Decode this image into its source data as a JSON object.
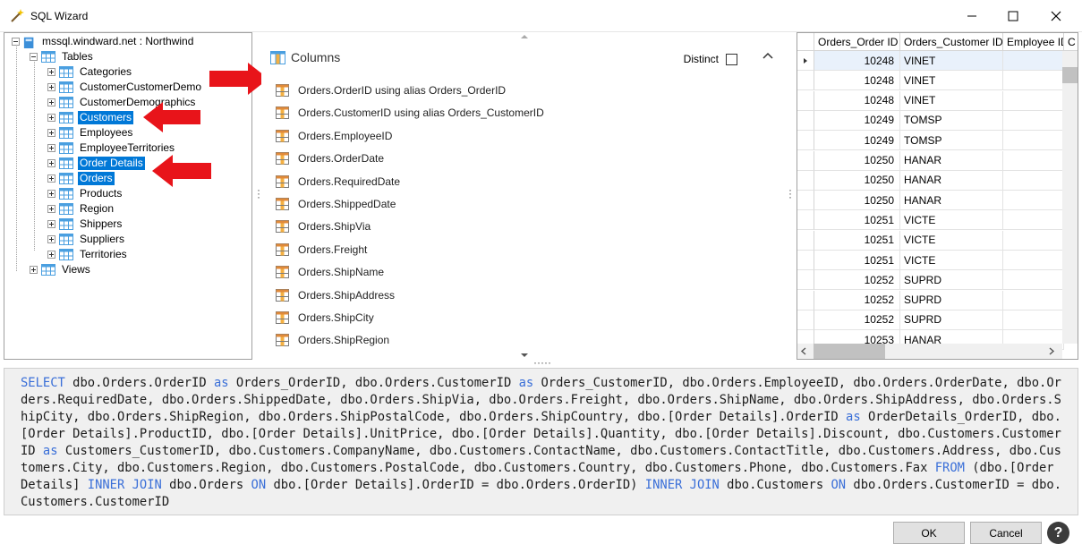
{
  "window": {
    "title": "SQL Wizard"
  },
  "tree": {
    "root_label": "mssql.windward.net : Northwind",
    "tables_label": "Tables",
    "tables": [
      {
        "label": "Categories",
        "selected": false
      },
      {
        "label": "CustomerCustomerDemo",
        "selected": false
      },
      {
        "label": "CustomerDemographics",
        "selected": false
      },
      {
        "label": "Customers",
        "selected": true
      },
      {
        "label": "Employees",
        "selected": false
      },
      {
        "label": "EmployeeTerritories",
        "selected": false
      },
      {
        "label": "Order Details",
        "selected": true
      },
      {
        "label": "Orders",
        "selected": true
      },
      {
        "label": "Products",
        "selected": false
      },
      {
        "label": "Region",
        "selected": false
      },
      {
        "label": "Shippers",
        "selected": false
      },
      {
        "label": "Suppliers",
        "selected": false
      },
      {
        "label": "Territories",
        "selected": false
      }
    ],
    "views_label": "Views"
  },
  "columns_panel": {
    "header": "Columns",
    "distinct_label": "Distinct",
    "items": [
      "Orders.OrderID using alias Orders_OrderID",
      "Orders.CustomerID using alias Orders_CustomerID",
      "Orders.EmployeeID",
      "Orders.OrderDate",
      "Orders.RequiredDate",
      "Orders.ShippedDate",
      "Orders.ShipVia",
      "Orders.Freight",
      "Orders.ShipName",
      "Orders.ShipAddress",
      "Orders.ShipCity",
      "Orders.ShipRegion"
    ]
  },
  "grid": {
    "headers": [
      "Orders_Order ID",
      "Orders_Customer ID",
      "Employee ID",
      "C"
    ],
    "rows": [
      [
        "10248",
        "VINET"
      ],
      [
        "10248",
        "VINET"
      ],
      [
        "10248",
        "VINET"
      ],
      [
        "10249",
        "TOMSP"
      ],
      [
        "10249",
        "TOMSP"
      ],
      [
        "10250",
        "HANAR"
      ],
      [
        "10250",
        "HANAR"
      ],
      [
        "10250",
        "HANAR"
      ],
      [
        "10251",
        "VICTE"
      ],
      [
        "10251",
        "VICTE"
      ],
      [
        "10251",
        "VICTE"
      ],
      [
        "10252",
        "SUPRD"
      ],
      [
        "10252",
        "SUPRD"
      ],
      [
        "10252",
        "SUPRD"
      ],
      [
        "10253",
        "HANAR"
      ]
    ]
  },
  "sql": {
    "tokens": [
      {
        "t": "SELECT",
        "kw": true
      },
      {
        "t": " dbo.Orders.OrderID ",
        "kw": false
      },
      {
        "t": "as",
        "kw": true
      },
      {
        "t": " Orders_OrderID, dbo.Orders.CustomerID ",
        "kw": false
      },
      {
        "t": "as",
        "kw": true
      },
      {
        "t": " Orders_CustomerID, dbo.Orders.EmployeeID, dbo.Orders.OrderDate, dbo.Orders.RequiredDate, dbo.Orders.ShippedDate, dbo.Orders.ShipVia, dbo.Orders.Freight, dbo.Orders.ShipName, dbo.Orders.ShipAddress, dbo.Orders.ShipCity, dbo.Orders.ShipRegion, dbo.Orders.ShipPostalCode, dbo.Orders.ShipCountry, dbo.[Order Details].OrderID ",
        "kw": false
      },
      {
        "t": "as",
        "kw": true
      },
      {
        "t": " OrderDetails_OrderID, dbo.[Order Details].ProductID, dbo.[Order Details].UnitPrice, dbo.[Order Details].Quantity, dbo.[Order Details].Discount, dbo.Customers.CustomerID ",
        "kw": false
      },
      {
        "t": "as",
        "kw": true
      },
      {
        "t": " Customers_CustomerID, dbo.Customers.CompanyName, dbo.Customers.ContactName, dbo.Customers.ContactTitle, dbo.Customers.Address, dbo.Customers.City, dbo.Customers.Region, dbo.Customers.PostalCode, dbo.Customers.Country, dbo.Customers.Phone, dbo.Customers.Fax ",
        "kw": false
      },
      {
        "t": "FROM",
        "kw": true
      },
      {
        "t": " (dbo.[Order Details] ",
        "kw": false
      },
      {
        "t": "INNER JOIN",
        "kw": true
      },
      {
        "t": " dbo.Orders ",
        "kw": false
      },
      {
        "t": "ON",
        "kw": true
      },
      {
        "t": " dbo.[Order Details].OrderID = dbo.Orders.OrderID) ",
        "kw": false
      },
      {
        "t": "INNER JOIN",
        "kw": true
      },
      {
        "t": " dbo.Customers ",
        "kw": false
      },
      {
        "t": "ON",
        "kw": true
      },
      {
        "t": " dbo.Orders.CustomerID = dbo.Customers.CustomerID",
        "kw": false
      }
    ]
  },
  "buttons": {
    "ok": "OK",
    "cancel": "Cancel",
    "help": "?"
  },
  "icons": {
    "title": "wand-icon",
    "db": "database-icon",
    "table": "table-icon",
    "column": "column-icon",
    "arrow": "red-arrow-icon"
  },
  "colors": {
    "selection": "#0078d7",
    "keyword": "#3a6fd8",
    "arrow": "#e8141a",
    "sql_bg": "#f0f0f0"
  }
}
